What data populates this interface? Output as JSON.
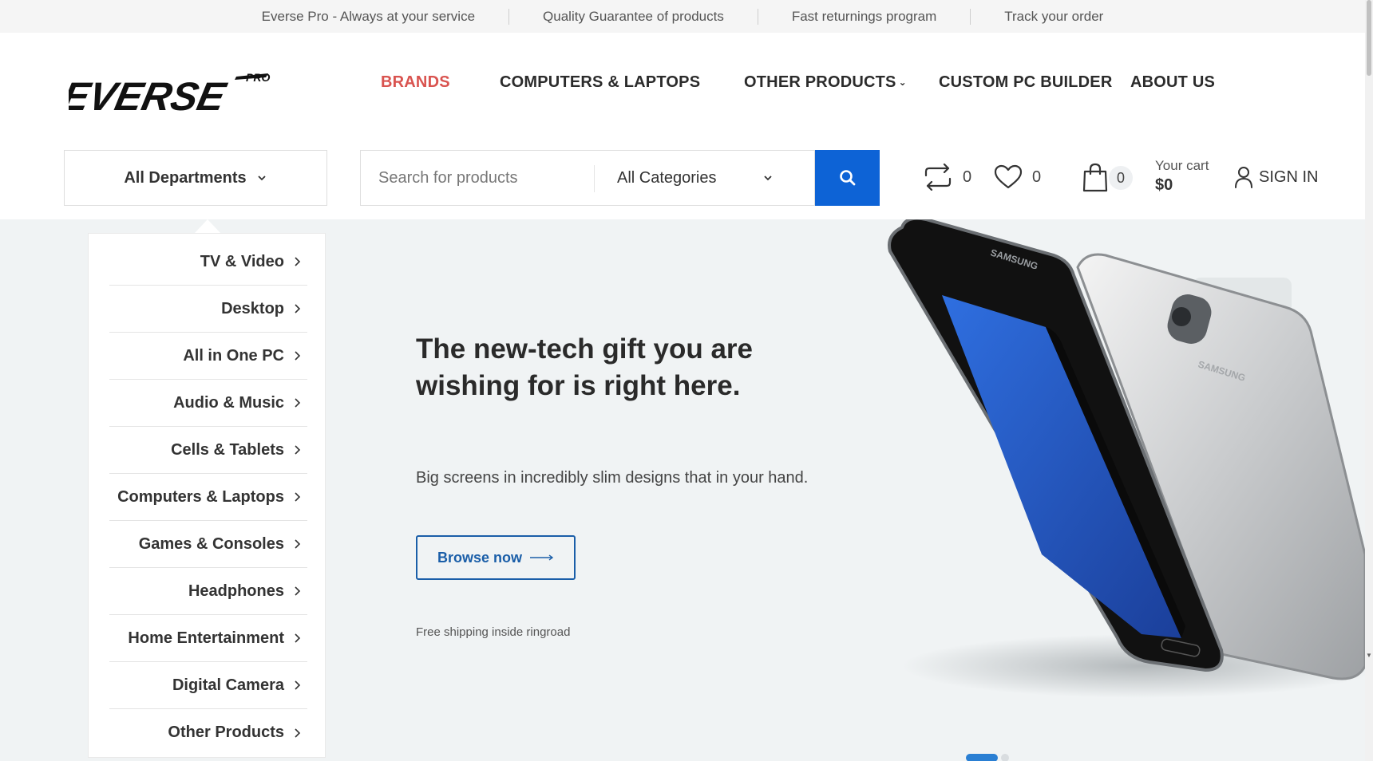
{
  "topbar": {
    "items": [
      "Everse Pro - Always at your service",
      "Quality Guarantee of products",
      "Fast returnings program",
      "Track your order"
    ]
  },
  "logo": {
    "text": "EVERSE",
    "tag": "PRO"
  },
  "nav": {
    "items": [
      {
        "label": "BRANDS",
        "active": true
      },
      {
        "label": "COMPUTERS & LAPTOPS"
      },
      {
        "label": "OTHER PRODUCTS",
        "has_dropdown": true
      },
      {
        "label": "CUSTOM PC BUILDER"
      },
      {
        "label": "ABOUT US"
      }
    ]
  },
  "departments": {
    "label": "All Departments",
    "icon": "chevron-down-icon"
  },
  "search": {
    "placeholder": "Search for products",
    "value": "",
    "category": "All Categories",
    "button_icon": "search-icon"
  },
  "header_actions": {
    "compare_count": "0",
    "wishlist_count": "0",
    "cart_count": "0",
    "cart_label": "Your cart",
    "cart_total": "$0",
    "signin_label": "SIGN IN"
  },
  "menu": {
    "items": [
      "TV & Video",
      "Desktop",
      "All in One PC",
      "Audio & Music",
      "Cells & Tablets",
      "Computers & Laptops",
      "Games & Consoles",
      "Headphones",
      "Home Entertainment",
      "Digital Camera",
      "Other Products"
    ]
  },
  "hero": {
    "title": "The new-tech gift you are wishing for is right here.",
    "subtitle": "Big screens in incredibly slim designs that in your hand.",
    "cta": "Browse now",
    "note": "Free shipping inside ringroad",
    "brand_mark": "SAMSUNG",
    "slides": {
      "active": 1,
      "total": 2
    }
  },
  "colors": {
    "accent": "#0d63d6",
    "active_nav": "#d9534f",
    "cta": "#1a5ea8",
    "hero_bg": "#f0f3f4",
    "topbar_bg": "#f5f5f5"
  }
}
